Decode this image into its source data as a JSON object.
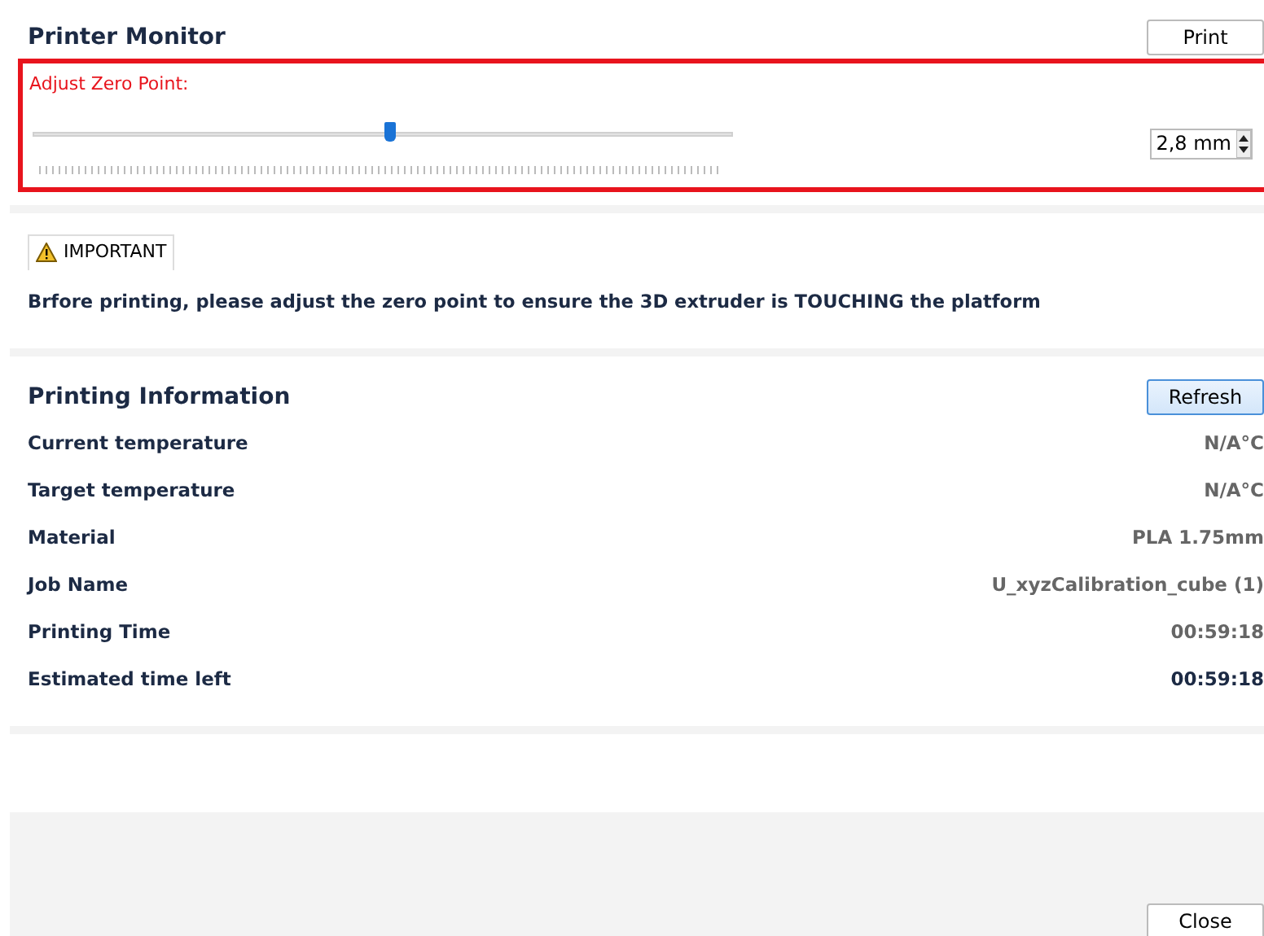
{
  "header": {
    "title": "Printer Monitor",
    "print_button": "Print"
  },
  "zero_point": {
    "label": "Adjust Zero Point:",
    "level": 0.51,
    "value": "2,8 mm"
  },
  "notice": {
    "badge": "IMPORTANT",
    "message": "Brfore printing, please adjust the zero point to ensure the 3D extruder is TOUCHING the platform"
  },
  "info": {
    "title": "Printing Information",
    "refresh_button": "Refresh",
    "rows": [
      {
        "label": "Current temperature",
        "value": "N/A°C",
        "emphasis": false
      },
      {
        "label": "Target temperature",
        "value": "N/A°C",
        "emphasis": false
      },
      {
        "label": "Material",
        "value": "PLA 1.75mm",
        "emphasis": false
      },
      {
        "label": "Job Name",
        "value": "U_xyzCalibration_cube (1)",
        "emphasis": false
      },
      {
        "label": "Printing Time",
        "value": "00:59:18",
        "emphasis": false
      },
      {
        "label": "Estimated time left",
        "value": "00:59:18",
        "emphasis": true
      }
    ]
  },
  "footer": {
    "close_button": "Close"
  }
}
